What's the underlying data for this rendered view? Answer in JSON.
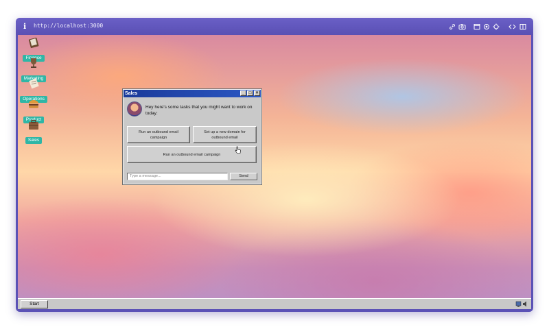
{
  "browser": {
    "url": "http://localhost:3000",
    "icons": [
      "info-icon",
      "link-icon",
      "camera-icon",
      "window-icon",
      "bug-icon",
      "crosshair-icon",
      "code-icon",
      "sidebar-icon"
    ]
  },
  "desktop": {
    "icons": [
      {
        "label": "Finance",
        "icon": "ledger-icon"
      },
      {
        "label": "Marketing",
        "icon": "trophy-icon"
      },
      {
        "label": "Operations",
        "icon": "document-icon"
      },
      {
        "label": "Product",
        "icon": "burger-icon"
      },
      {
        "label": "Sales",
        "icon": "briefcase-icon"
      }
    ]
  },
  "window": {
    "title": "Sales",
    "greeting": "Hey here's some tasks that you might want to work on today:",
    "tasks": [
      "Run an outbound email campaign",
      "Set up a new domain for outbound email",
      "Run an outbound email campaign"
    ],
    "input_placeholder": "Type a message...",
    "send_label": "Send"
  },
  "taskbar": {
    "start_label": "Start"
  },
  "colors": {
    "accent": "#5b52b6",
    "desktop_label": "#2fb6a6",
    "title_bar": "#1a3a9a"
  }
}
